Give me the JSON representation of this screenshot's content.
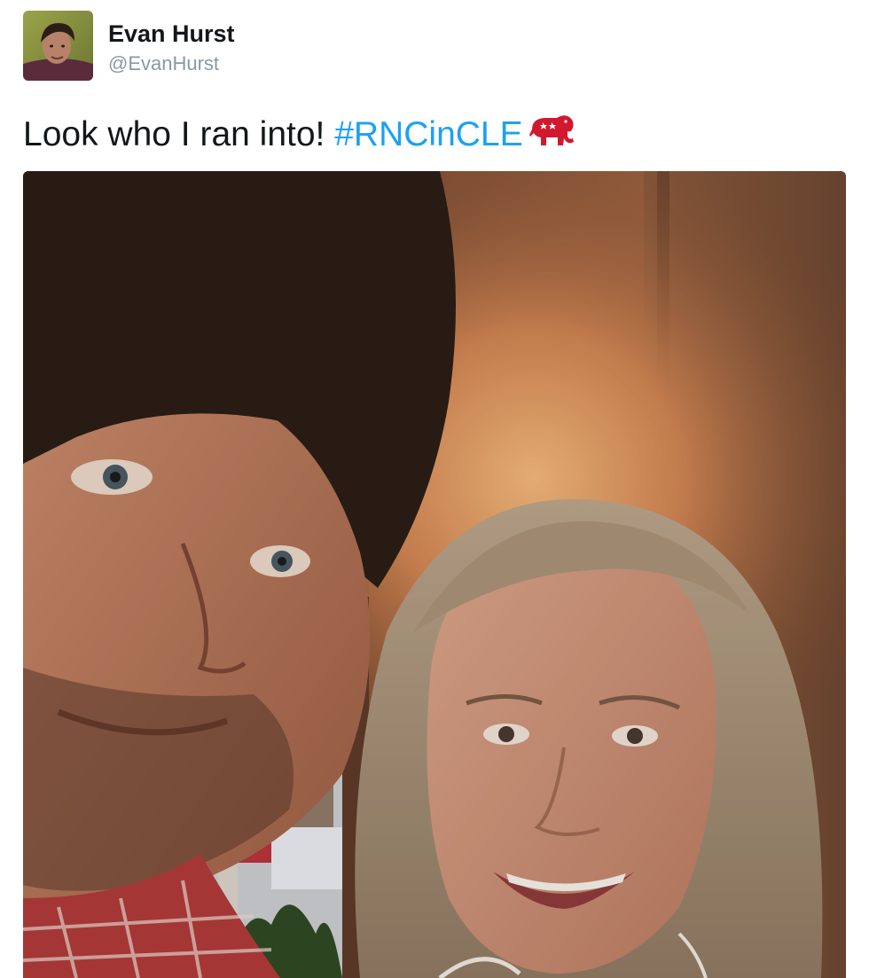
{
  "user": {
    "display_name": "Evan Hurst",
    "handle": "@EvanHurst"
  },
  "tweet": {
    "text_prefix": "Look who I ran into! ",
    "hashtag": "#RNCinCLE",
    "hashtag_emoji": "red-elephant-icon"
  },
  "photo": {
    "subject": "selfie-photo"
  },
  "colors": {
    "name": "#14171a",
    "handle": "#8899a6",
    "hashtag": "#1da1f2",
    "elephant": "#d1182f"
  }
}
